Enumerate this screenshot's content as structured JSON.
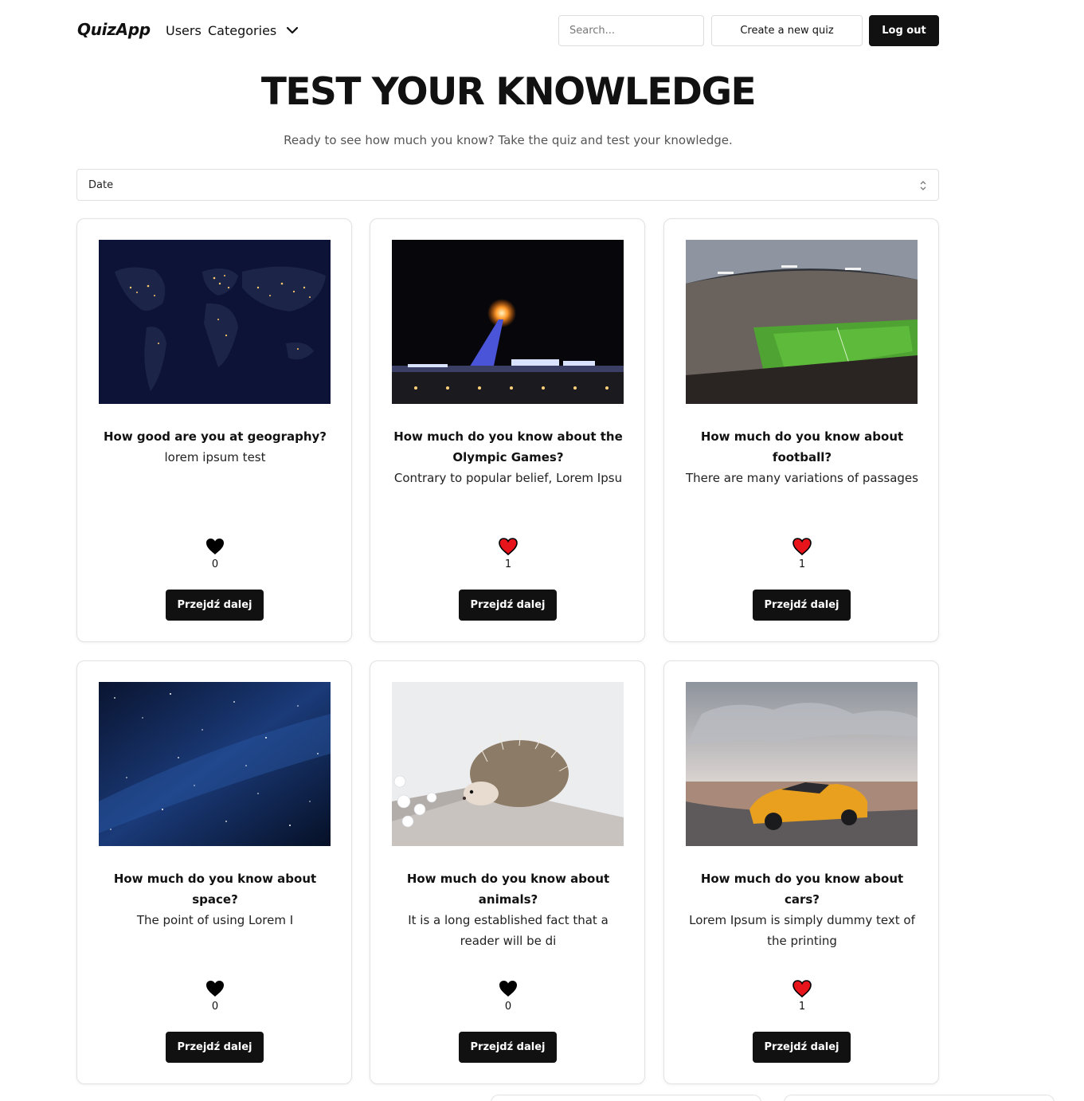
{
  "nav": {
    "logo": "QuizApp",
    "links": [
      "Users",
      "Categories"
    ],
    "search_placeholder": "Search...",
    "create_label": "Create a new quiz",
    "logout_label": "Log out"
  },
  "hero": {
    "title": "TEST YOUR KNOWLEDGE",
    "subtitle": "Ready to see how much you know? Take the quiz and test your knowledge."
  },
  "sort": {
    "selected": "Date"
  },
  "colors": {
    "primary": "#111111",
    "liked_heart": "#e8141c",
    "unliked_heart": "#000000"
  },
  "cards": [
    {
      "title": "How good are you at geography?",
      "description": "lorem ipsum test",
      "likes": "0",
      "liked": false,
      "button": "Przejdź dalej",
      "image": "world-map-at-night"
    },
    {
      "title": "How much do you know about the Olympic Games?",
      "description": "Contrary to popular belief, Lorem Ipsu",
      "likes": "1",
      "liked": true,
      "button": "Przejdź dalej",
      "image": "olympic-flame"
    },
    {
      "title": "How much do you know about football?",
      "description": "There are many variations of passages",
      "likes": "1",
      "liked": true,
      "button": "Przejdź dalej",
      "image": "football-stadium"
    },
    {
      "title": "How much do you know about space?",
      "description": "The point of using Lorem I",
      "likes": "0",
      "liked": false,
      "button": "Przejdź dalej",
      "image": "starry-space"
    },
    {
      "title": "How much do you know about animals?",
      "description": "It is a long established fact that a reader will be di",
      "likes": "0",
      "liked": false,
      "button": "Przejdź dalej",
      "image": "hedgehog"
    },
    {
      "title": "How much do you know about cars?",
      "description": "Lorem Ipsum is simply dummy text of the printing",
      "likes": "1",
      "liked": true,
      "button": "Przejdź dalej",
      "image": "yellow-sports-car"
    }
  ]
}
